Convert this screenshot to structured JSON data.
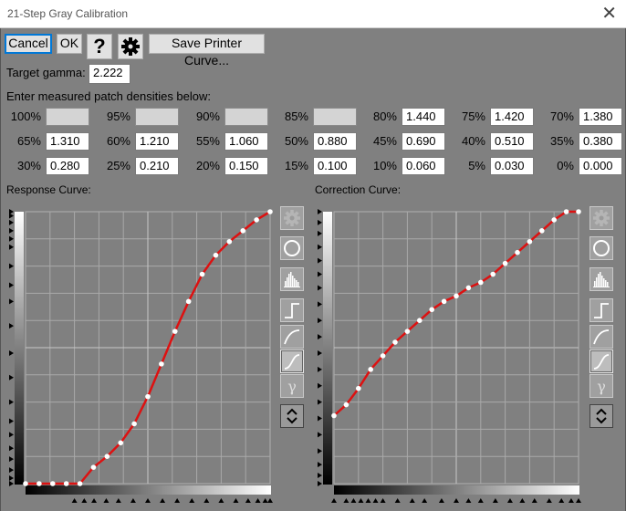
{
  "window": {
    "title": "21-Step Gray Calibration",
    "close_glyph": "✕"
  },
  "toolbar": {
    "cancel_label": "Cancel",
    "ok_label": "OK",
    "help_label": "?",
    "settings_icon": "gear-icon",
    "save_curve_label": "Save Printer Curve..."
  },
  "gamma": {
    "label": "Target gamma:",
    "value": "2.222"
  },
  "patches": {
    "instruction": "Enter measured patch densities below:",
    "items": [
      {
        "label": "100%",
        "value": ""
      },
      {
        "label": "95%",
        "value": ""
      },
      {
        "label": "90%",
        "value": ""
      },
      {
        "label": "85%",
        "value": ""
      },
      {
        "label": "80%",
        "value": "1.440"
      },
      {
        "label": "75%",
        "value": "1.420"
      },
      {
        "label": "70%",
        "value": "1.380"
      },
      {
        "label": "65%",
        "value": "1.310"
      },
      {
        "label": "60%",
        "value": "1.210"
      },
      {
        "label": "55%",
        "value": "1.060"
      },
      {
        "label": "50%",
        "value": "0.880"
      },
      {
        "label": "45%",
        "value": "0.690"
      },
      {
        "label": "40%",
        "value": "0.510"
      },
      {
        "label": "35%",
        "value": "0.380"
      },
      {
        "label": "30%",
        "value": "0.280"
      },
      {
        "label": "25%",
        "value": "0.210"
      },
      {
        "label": "20%",
        "value": "0.150"
      },
      {
        "label": "15%",
        "value": "0.100"
      },
      {
        "label": "10%",
        "value": "0.060"
      },
      {
        "label": "5%",
        "value": "0.030"
      },
      {
        "label": "0%",
        "value": "0.000"
      }
    ]
  },
  "response_curve": {
    "label": "Response Curve:",
    "points": [
      [
        0,
        0
      ],
      [
        0.05,
        0
      ],
      [
        0.1,
        0
      ],
      [
        0.15,
        0
      ],
      [
        0.2,
        0
      ],
      [
        0.25,
        0.06
      ],
      [
        0.3,
        0.1
      ],
      [
        0.35,
        0.15
      ],
      [
        0.4,
        0.22
      ],
      [
        0.45,
        0.32
      ],
      [
        0.5,
        0.44
      ],
      [
        0.55,
        0.56
      ],
      [
        0.6,
        0.67
      ],
      [
        0.65,
        0.77
      ],
      [
        0.7,
        0.84
      ],
      [
        0.75,
        0.89
      ],
      [
        0.8,
        0.93
      ],
      [
        0.85,
        0.97
      ],
      [
        0.9,
        1.0
      ]
    ]
  },
  "correction_curve": {
    "label": "Correction Curve:",
    "points": [
      [
        0,
        0.25
      ],
      [
        0.05,
        0.29
      ],
      [
        0.1,
        0.35
      ],
      [
        0.15,
        0.42
      ],
      [
        0.2,
        0.47
      ],
      [
        0.25,
        0.52
      ],
      [
        0.3,
        0.56
      ],
      [
        0.35,
        0.6
      ],
      [
        0.4,
        0.64
      ],
      [
        0.45,
        0.67
      ],
      [
        0.5,
        0.69
      ],
      [
        0.55,
        0.72
      ],
      [
        0.6,
        0.74
      ],
      [
        0.65,
        0.77
      ],
      [
        0.7,
        0.81
      ],
      [
        0.75,
        0.85
      ],
      [
        0.8,
        0.89
      ],
      [
        0.85,
        0.93
      ],
      [
        0.9,
        0.97
      ],
      [
        0.95,
        1.0
      ],
      [
        1.0,
        1.0
      ]
    ]
  },
  "side_tools": [
    "gear-icon",
    "circle-icon",
    "histogram-icon",
    "step-curve-icon",
    "smooth-curve-icon",
    "s-curve-icon",
    "gamma-icon",
    "up-down-icon"
  ],
  "colors": {
    "curve": "#dd1111",
    "background": "#808080",
    "grid": "#a9a9a9"
  }
}
